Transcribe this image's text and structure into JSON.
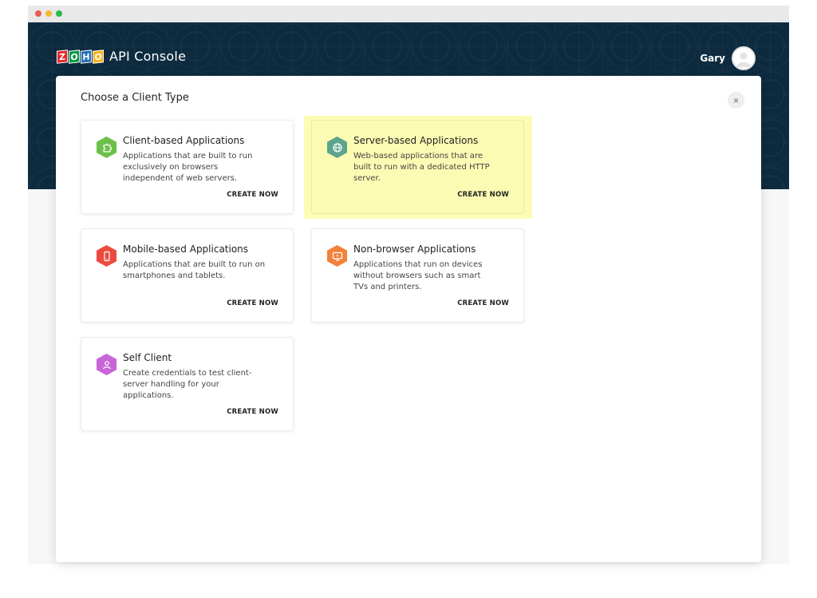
{
  "header": {
    "logo_letters": [
      "Z",
      "O",
      "H",
      "O"
    ],
    "logo_colors": [
      "#e42527",
      "#089949",
      "#226db4",
      "#f9b21d"
    ],
    "app_title": "API Console",
    "user_name": "Gary"
  },
  "modal": {
    "title": "Choose a Client Type",
    "close_label": "×"
  },
  "cards": [
    {
      "title": "Client-based Applications",
      "description": "Applications that are built to run exclusively on browsers independent of web servers.",
      "cta": "CREATE NOW",
      "icon": "puzzle-icon",
      "color": "#6cc04a"
    },
    {
      "title": "Server-based Applications",
      "description": "Web-based applications that are built to run with a dedicated HTTP server.",
      "cta": "CREATE NOW",
      "icon": "globe-icon",
      "color": "#5ca58c",
      "highlighted": true
    },
    {
      "title": "Mobile-based Applications",
      "description": "Applications that are built to run on smartphones and tablets.",
      "cta": "CREATE NOW",
      "icon": "mobile-icon",
      "color": "#eb4b3e"
    },
    {
      "title": "Non-browser Applications",
      "description": "Applications that run on devices without browsers such as smart TVs and printers.",
      "cta": "CREATE NOW",
      "icon": "tv-icon",
      "color": "#f2813a"
    },
    {
      "title": "Self Client",
      "description": "Create credentials to test client-server handling for your applications.",
      "cta": "CREATE NOW",
      "icon": "user-icon",
      "color": "#c765d6"
    }
  ]
}
